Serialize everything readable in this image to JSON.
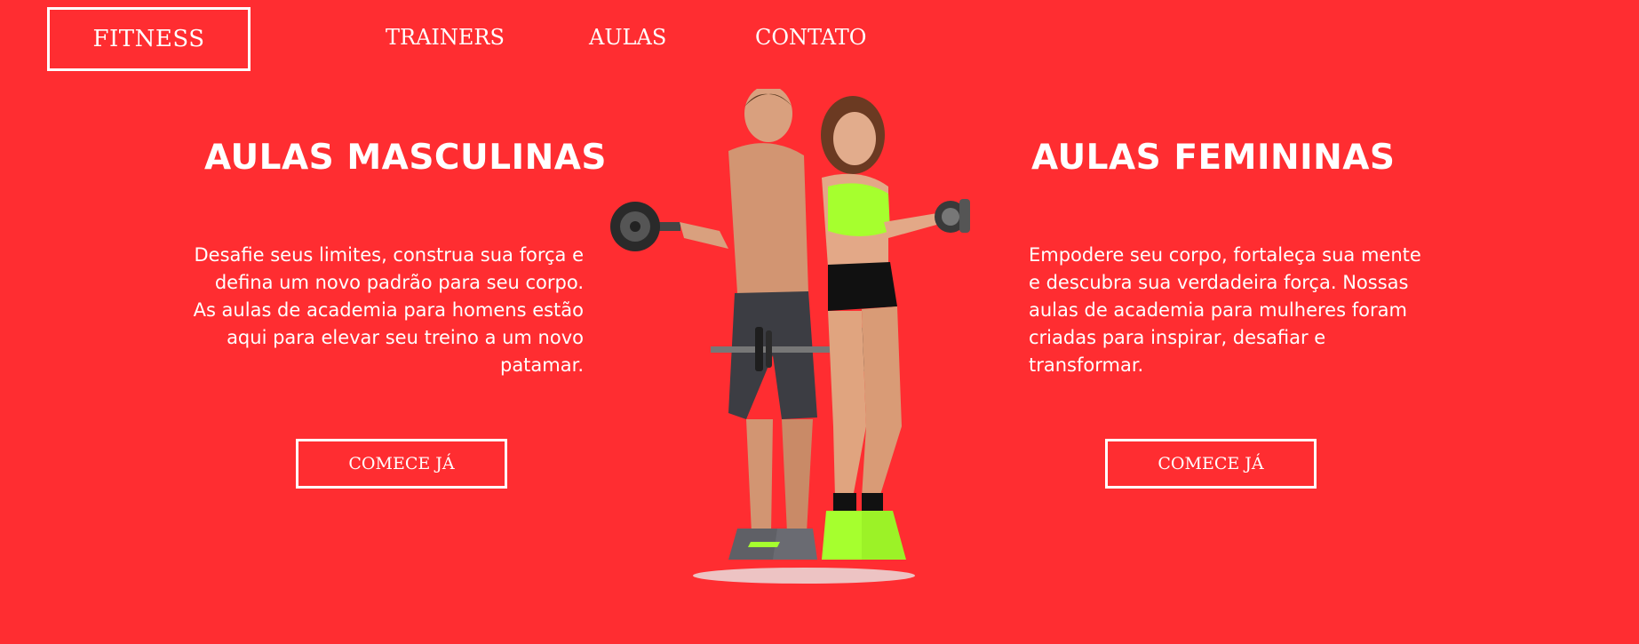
{
  "brand": {
    "logo_text": "FITNESS"
  },
  "nav": {
    "items": [
      {
        "label": "TRAINERS"
      },
      {
        "label": "AULAS"
      },
      {
        "label": "CONTATO"
      }
    ]
  },
  "left_section": {
    "title": "AULAS MASCULINAS",
    "text": "Desafie seus limites, construa sua força e defina um novo padrão para seu corpo. As aulas de academia para homens estão aqui para elevar seu treino a um novo patamar.",
    "button_label": "COMECE JÁ"
  },
  "right_section": {
    "title": "AULAS FEMININAS",
    "text": "Empodere seu corpo, fortaleça sua mente e descubra sua verdadeira força. Nossas aulas de academia para mulheres foram criadas para inspirar, desafiar e transformar.",
    "button_label": "COMECE JÁ"
  },
  "colors": {
    "background": "#ff2d31",
    "text": "#ffffff",
    "accent_green": "#a6ff2e"
  }
}
